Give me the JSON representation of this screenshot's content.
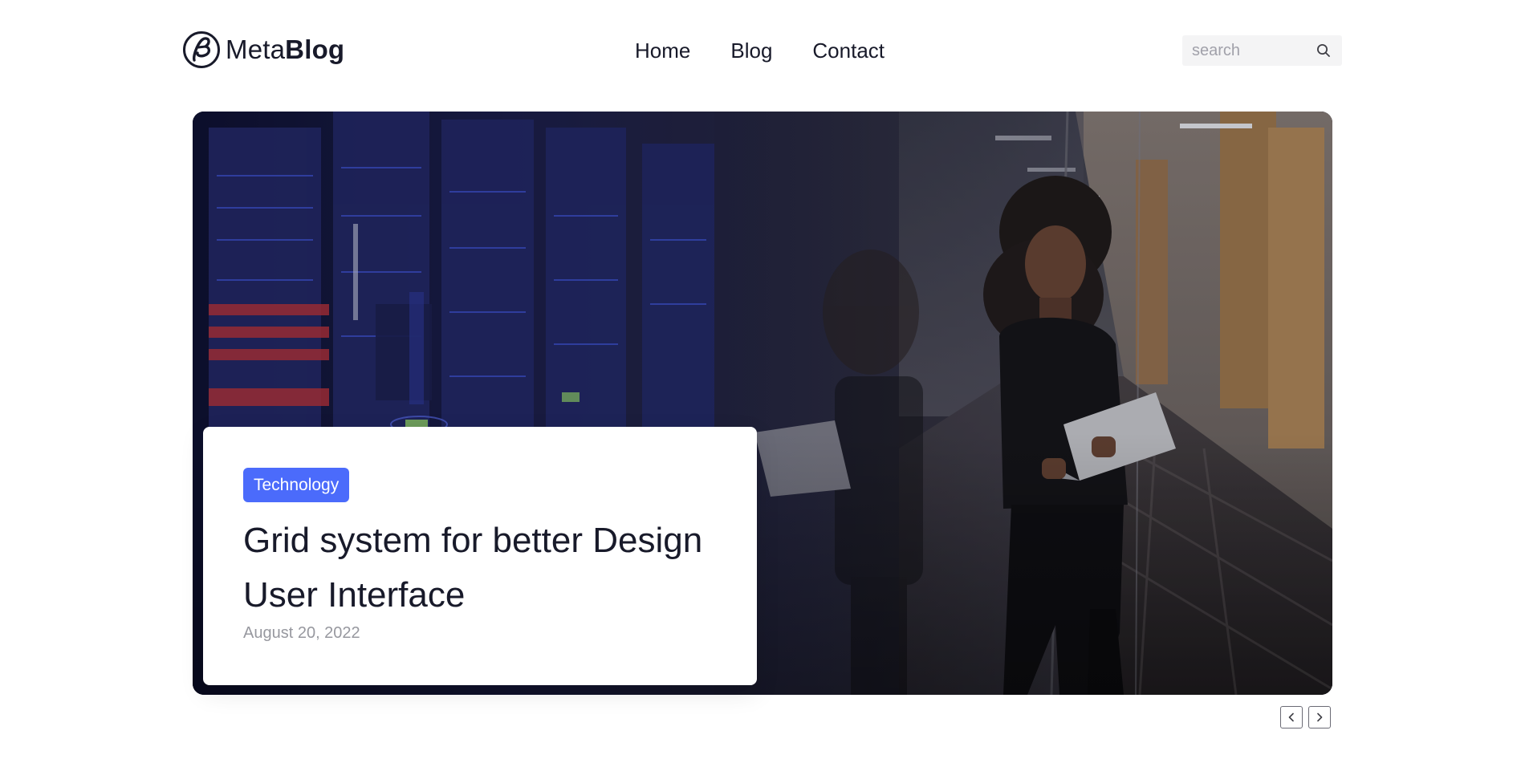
{
  "brand": {
    "name_light": "Meta",
    "name_bold": "Blog",
    "logo_icon": "circular-b-logo-icon"
  },
  "nav": {
    "items": [
      {
        "label": "Home"
      },
      {
        "label": "Blog"
      },
      {
        "label": "Contact"
      }
    ]
  },
  "search": {
    "placeholder": "search",
    "value": "",
    "icon": "search-icon"
  },
  "hero": {
    "image_icon": "hero-photo",
    "category": "Technology",
    "title": "Grid system for better Design User Interface",
    "date": "August 20, 2022"
  },
  "slider": {
    "prev_icon": "chevron-left-icon",
    "next_icon": "chevron-right-icon"
  },
  "colors": {
    "accent": "#4b6bfb",
    "text": "#181a2a",
    "muted": "#97989f",
    "search_bg": "#f4f4f5"
  }
}
